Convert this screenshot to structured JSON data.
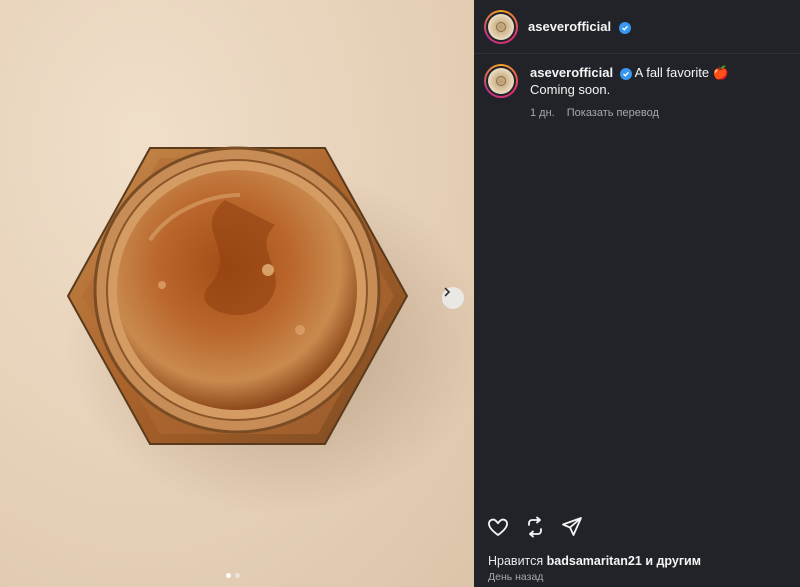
{
  "post": {
    "username": "aseverofficial",
    "caption_text": "A fall favorite",
    "caption_emoji": "🍎",
    "caption_line2": "Coming soon.",
    "age": "1 дн.",
    "translate_label": "Показать перевод",
    "likes_prefix": "Нравится",
    "likes_user": "badsamaritan21",
    "likes_suffix": "и другим",
    "time_ago": "День назад"
  },
  "carousel": {
    "current": 1,
    "total": 2
  },
  "icons": {
    "verified": "verified-badge-icon",
    "next": "chevron-right-icon",
    "like": "heart-icon",
    "repost": "repost-icon",
    "share": "send-icon"
  },
  "colors": {
    "panel_bg": "#212328",
    "verified_blue": "#3897f0",
    "muted_text": "#a8a8a8"
  }
}
